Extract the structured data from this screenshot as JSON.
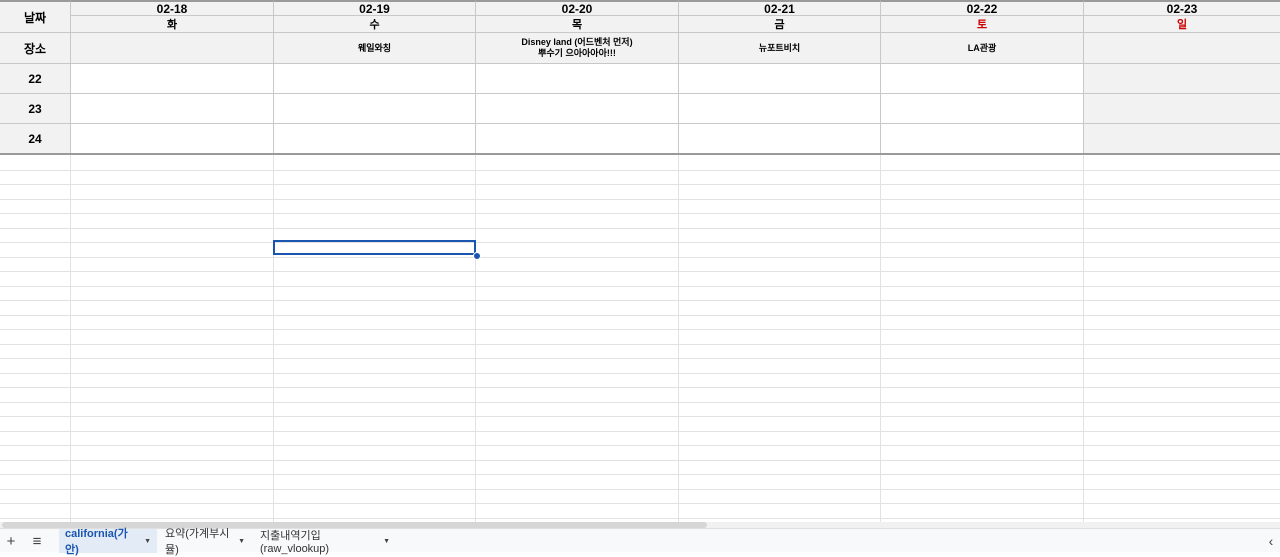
{
  "header": {
    "date_label": "날짜",
    "place_label": "장소",
    "dates": [
      "02-18",
      "02-19",
      "02-20",
      "02-21",
      "02-22",
      "02-23"
    ],
    "days": [
      "화",
      "수",
      "목",
      "금",
      "토",
      "일"
    ],
    "places": [
      "",
      "웨일와칭",
      "Disney land (어드벤처 먼저)\n뿌수기 으아아아아!!!",
      "뉴포트비치",
      "LA관광",
      ""
    ]
  },
  "rows": [
    {
      "label": "22"
    },
    {
      "label": "23"
    },
    {
      "label": "24"
    }
  ],
  "colors": {
    "weekend_red": "#cc0000",
    "header_gray": "#f2f2f2",
    "selection_blue": "#1a56b0"
  },
  "tabbar": {
    "add_icon": "+",
    "menu_icon": "≡",
    "collapse_icon": "‹",
    "tabs": [
      {
        "label": "california(가안)",
        "active": true
      },
      {
        "label": "요약(가계부시뮬)",
        "active": false
      },
      {
        "label": "지출내역기입(raw_vlookup)",
        "active": false
      }
    ]
  }
}
